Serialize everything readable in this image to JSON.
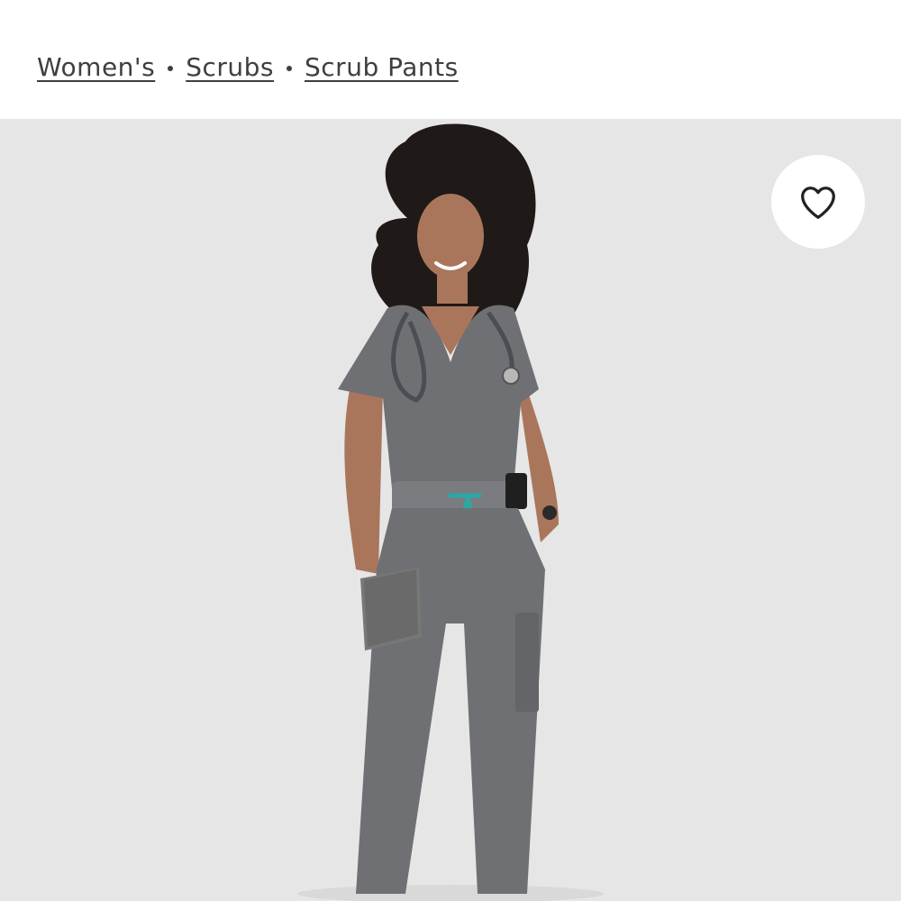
{
  "breadcrumb": {
    "items": [
      {
        "label": "Women's"
      },
      {
        "label": "Scrubs"
      },
      {
        "label": "Scrub Pants"
      }
    ]
  },
  "product_image": {
    "background_color": "#e6e6e6",
    "scrub_color": "#6f7073",
    "drawstring_color": "#2aa8a6"
  },
  "favorite": {
    "icon": "heart-outline-icon"
  }
}
